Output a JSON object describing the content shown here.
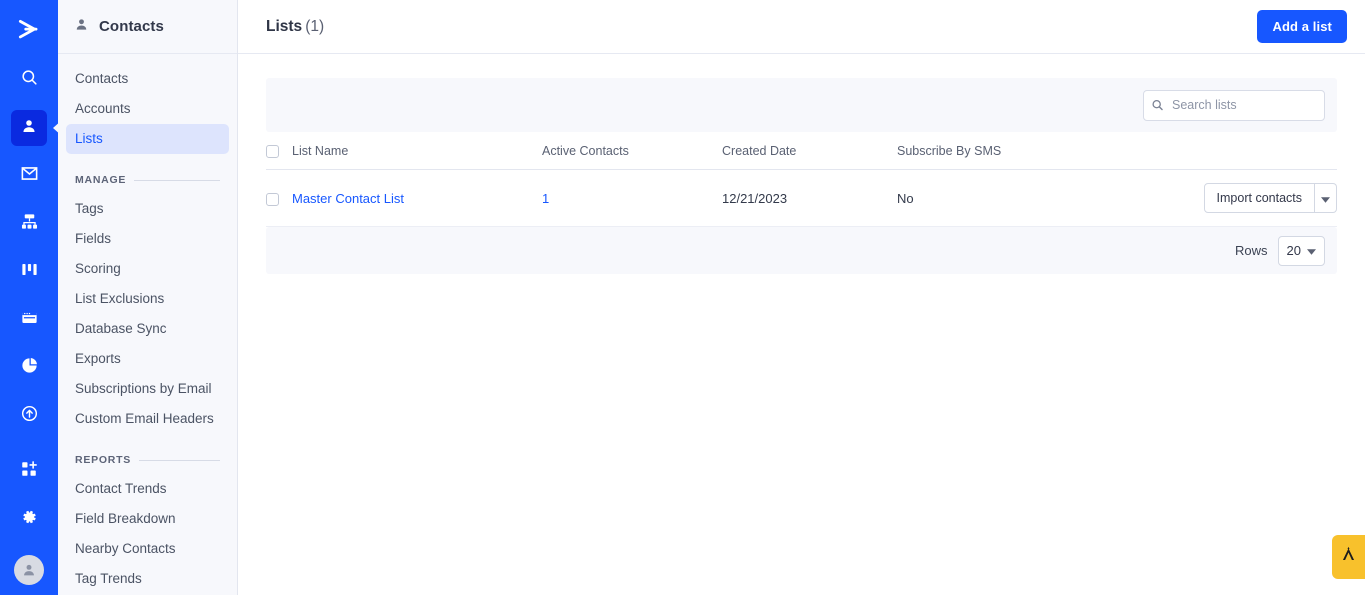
{
  "brand": {
    "rail_bg": "#1757ff",
    "rail_active_bg": "#0a2ae0",
    "accent": "#1757ff",
    "subnav_bg": "#f7f8fc",
    "fab_bg": "#f8c12c"
  },
  "rail": {
    "logo_name": "chevron-right-logo",
    "items": [
      {
        "name": "search-icon",
        "label": "Search",
        "active": false
      },
      {
        "name": "contacts-person-icon",
        "label": "Contacts",
        "active": true
      },
      {
        "name": "email-envelope-icon",
        "label": "Campaigns",
        "active": false
      },
      {
        "name": "automations-sitemap-icon",
        "label": "Automations",
        "active": false
      },
      {
        "name": "deals-kanban-icon",
        "label": "Deals",
        "active": false
      },
      {
        "name": "website-pages-icon",
        "label": "Website",
        "active": false
      },
      {
        "name": "reports-pie-chart-icon",
        "label": "Reports",
        "active": false
      },
      {
        "name": "upgrade-arrow-circle-icon",
        "label": "Upgrade",
        "active": false
      }
    ],
    "bottom_items": [
      {
        "name": "apps-grid-plus-icon",
        "label": "Apps"
      },
      {
        "name": "settings-gear-icon",
        "label": "Settings"
      },
      {
        "name": "user-avatar",
        "label": "Account"
      }
    ]
  },
  "sidebar": {
    "header": {
      "icon": "person-icon",
      "title": "Contacts"
    },
    "primary_items": [
      {
        "label": "Contacts",
        "active": false
      },
      {
        "label": "Accounts",
        "active": false
      },
      {
        "label": "Lists",
        "active": true
      }
    ],
    "groups": [
      {
        "label": "MANAGE",
        "items": [
          {
            "label": "Tags"
          },
          {
            "label": "Fields"
          },
          {
            "label": "Scoring"
          },
          {
            "label": "List Exclusions"
          },
          {
            "label": "Database Sync"
          },
          {
            "label": "Exports"
          },
          {
            "label": "Subscriptions by Email"
          },
          {
            "label": "Custom Email Headers"
          }
        ]
      },
      {
        "label": "REPORTS",
        "items": [
          {
            "label": "Contact Trends"
          },
          {
            "label": "Field Breakdown"
          },
          {
            "label": "Nearby Contacts"
          },
          {
            "label": "Tag Trends"
          }
        ]
      }
    ]
  },
  "topbar": {
    "title": "Lists",
    "count": "(1)",
    "add_button": "Add a list"
  },
  "toolbar": {
    "search_placeholder": "Search lists",
    "search_value": "",
    "search_icon": "search-icon"
  },
  "table": {
    "columns": [
      "List Name",
      "Active Contacts",
      "Created Date",
      "Subscribe By SMS"
    ],
    "rows": [
      {
        "list_name": "Master Contact List",
        "active_contacts": "1",
        "created_date": "12/21/2023",
        "subscribe_by_sms": "No",
        "action_label": "Import contacts"
      }
    ]
  },
  "footer": {
    "rows_label": "Rows",
    "rows_value": "20"
  },
  "fab": {
    "name": "accessibility-widget-icon"
  }
}
